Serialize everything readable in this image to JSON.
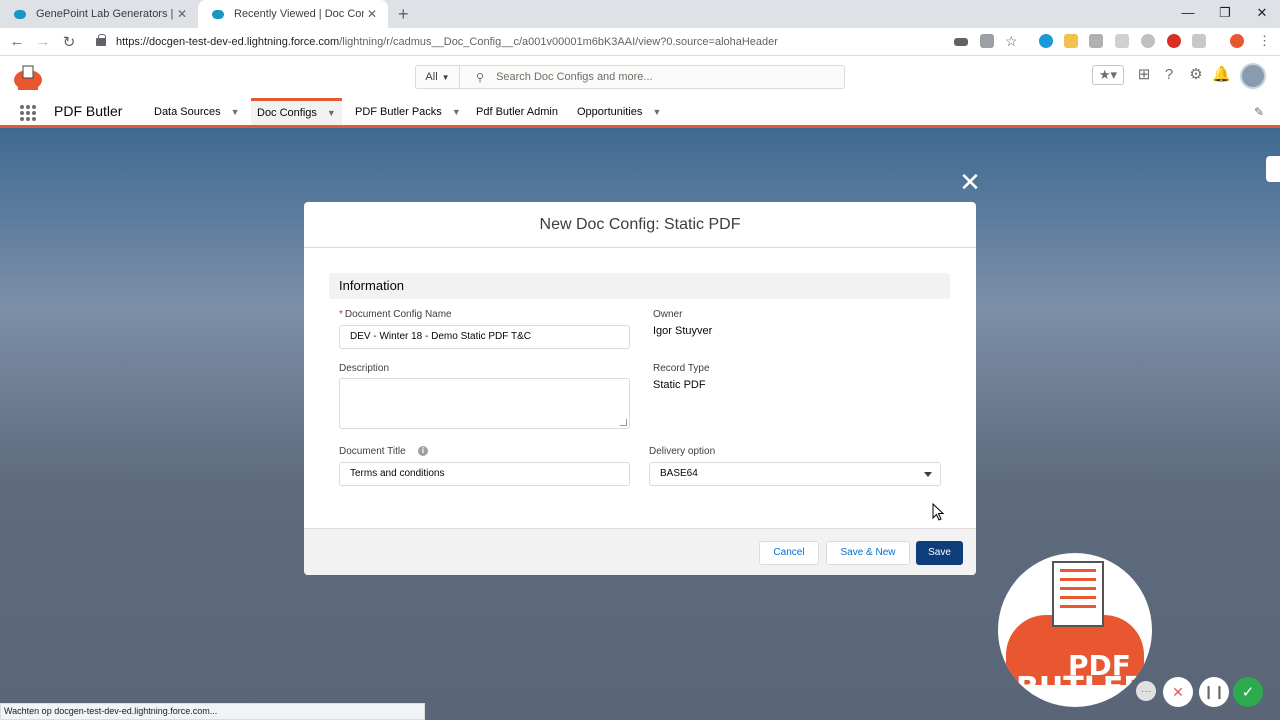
{
  "browser": {
    "tabs": [
      {
        "title": "GenePoint Lab Generators | Sales",
        "active": false
      },
      {
        "title": "Recently Viewed | Doc Configs | S",
        "active": true
      }
    ],
    "new_tab": "+",
    "window_controls": {
      "minimize": "—",
      "restore": "❐",
      "close": "✕"
    },
    "url_host": "https://docgen-test-dev-ed.lightning.force.com",
    "url_path": "/lightning/r/cadmus__Doc_Config__c/a001v00001m6bK3AAI/view?0.source=alohaHeader",
    "status_text": "Wachten op docgen-test-dev-ed.lightning.force.com..."
  },
  "sf_header": {
    "search_scope": "All",
    "search_placeholder": "Search Doc Configs and more..."
  },
  "nav": {
    "app_name": "PDF Butler",
    "items": [
      {
        "label": "Data Sources",
        "has_menu": true
      },
      {
        "label": "Doc Configs",
        "has_menu": true,
        "active": true
      },
      {
        "label": "PDF Butler Packs",
        "has_menu": true
      },
      {
        "label": "Pdf Butler Admin",
        "has_menu": false
      },
      {
        "label": "Opportunities",
        "has_menu": true
      }
    ]
  },
  "modal": {
    "title": "New Doc Config: Static PDF",
    "section_title": "Information",
    "fields": {
      "doc_config_name": {
        "label": "Document Config Name",
        "required_mark": "*",
        "value": "DEV - Winter 18 - Demo Static PDF T&C"
      },
      "owner": {
        "label": "Owner",
        "value": "Igor Stuyver"
      },
      "description": {
        "label": "Description",
        "value": ""
      },
      "record_type": {
        "label": "Record Type",
        "value": "Static PDF"
      },
      "document_title": {
        "label": "Document Title",
        "value": "Terms and conditions"
      },
      "delivery_option": {
        "label": "Delivery option",
        "value": "BASE64"
      }
    },
    "buttons": {
      "cancel": "Cancel",
      "save_new": "Save & New",
      "save": "Save"
    }
  },
  "badge": {
    "pdf": "PDF",
    "butler": "BUTLER"
  },
  "colors": {
    "brand_blue": "#0e3d7c",
    "accent_orange": "#e05a33",
    "link_blue": "#0070d2"
  }
}
